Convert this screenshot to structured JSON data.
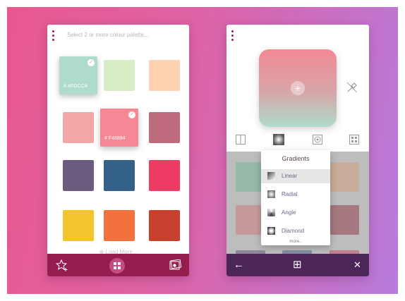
{
  "colors": {
    "left_bar": "#951c4f",
    "right_bar": "#4c2659",
    "accent": "#c54c7e"
  },
  "left_screen": {
    "menu_icon": "vertical-dots-icon",
    "header_text": "Select 2 or more colour palette...",
    "swatches": [
      {
        "color": "#AFDCCA",
        "hex_label": "# AFDCCA",
        "selected": true
      },
      {
        "color": "#D8EDC5",
        "hex_label": "",
        "selected": false
      },
      {
        "color": "#FFD2B2",
        "hex_label": "",
        "selected": false
      },
      {
        "color": "#F3A7A6",
        "hex_label": "",
        "selected": false
      },
      {
        "color": "#F48894",
        "hex_label": "# F48894",
        "selected": true
      },
      {
        "color": "#BD6B7D",
        "hex_label": "",
        "selected": false
      },
      {
        "color": "#6B5B7E",
        "hex_label": "",
        "selected": false
      },
      {
        "color": "#346187",
        "hex_label": "",
        "selected": false
      },
      {
        "color": "#ED3D64",
        "hex_label": "",
        "selected": false
      },
      {
        "color": "#F2C52C",
        "hex_label": "",
        "selected": false
      },
      {
        "color": "#F3713C",
        "hex_label": "",
        "selected": false
      },
      {
        "color": "#C8402E",
        "hex_label": "",
        "selected": false
      }
    ],
    "load_more": "Load More...",
    "bottom_icons": [
      "star-add-icon",
      "grid-icon",
      "gallery-icon"
    ]
  },
  "right_screen": {
    "menu_icon": "vertical-dots-icon",
    "preview_gradient": [
      "#F48894",
      "#AFDCCA"
    ],
    "preview_add_icon": "plus-icon",
    "tools": [
      "split-view-icon",
      "gradient-icon",
      "target-icon",
      "pattern-icon"
    ],
    "side_tool": "eyedropper-icon",
    "dropdown": {
      "title": "Gradients",
      "items": [
        {
          "label": "Linear",
          "icon": "linear-gradient-icon",
          "active": true
        },
        {
          "label": "Radial",
          "icon": "radial-gradient-icon",
          "active": false
        },
        {
          "label": "Angle",
          "icon": "angle-gradient-icon",
          "active": false
        },
        {
          "label": "Diamond",
          "icon": "diamond-gradient-icon",
          "active": false
        }
      ],
      "more": "more.."
    },
    "bottom_icons": [
      "back-arrow-icon",
      "grid-icon",
      "close-icon"
    ],
    "bottom_glyphs": {
      "back": "←",
      "grid": "⊞",
      "close": "✕"
    }
  }
}
